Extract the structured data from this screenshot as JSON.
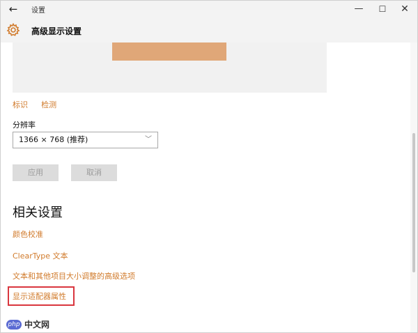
{
  "titlebar": {
    "back_icon": "←",
    "app_title": "设置",
    "minimize": "—",
    "maximize": "☐",
    "close": "✕"
  },
  "header": {
    "icon": "gear-icon",
    "title": "高级显示设置"
  },
  "display": {
    "links": [
      "标识",
      "检测"
    ],
    "resolution_label": "分辨率",
    "resolution_value": "1366 × 768 (推荐)",
    "apply": "应用",
    "cancel": "取消"
  },
  "related": {
    "title": "相关设置",
    "links": [
      "颜色校准",
      "ClearType 文本",
      "文本和其他项目大小调整的高级选项",
      "显示适配器属性"
    ]
  },
  "watermark": {
    "logo": "php",
    "text": "中文网"
  },
  "colors": {
    "accent": "#d17b2c",
    "monitor_tile": "#e0a778",
    "highlight": "#d9363e"
  }
}
